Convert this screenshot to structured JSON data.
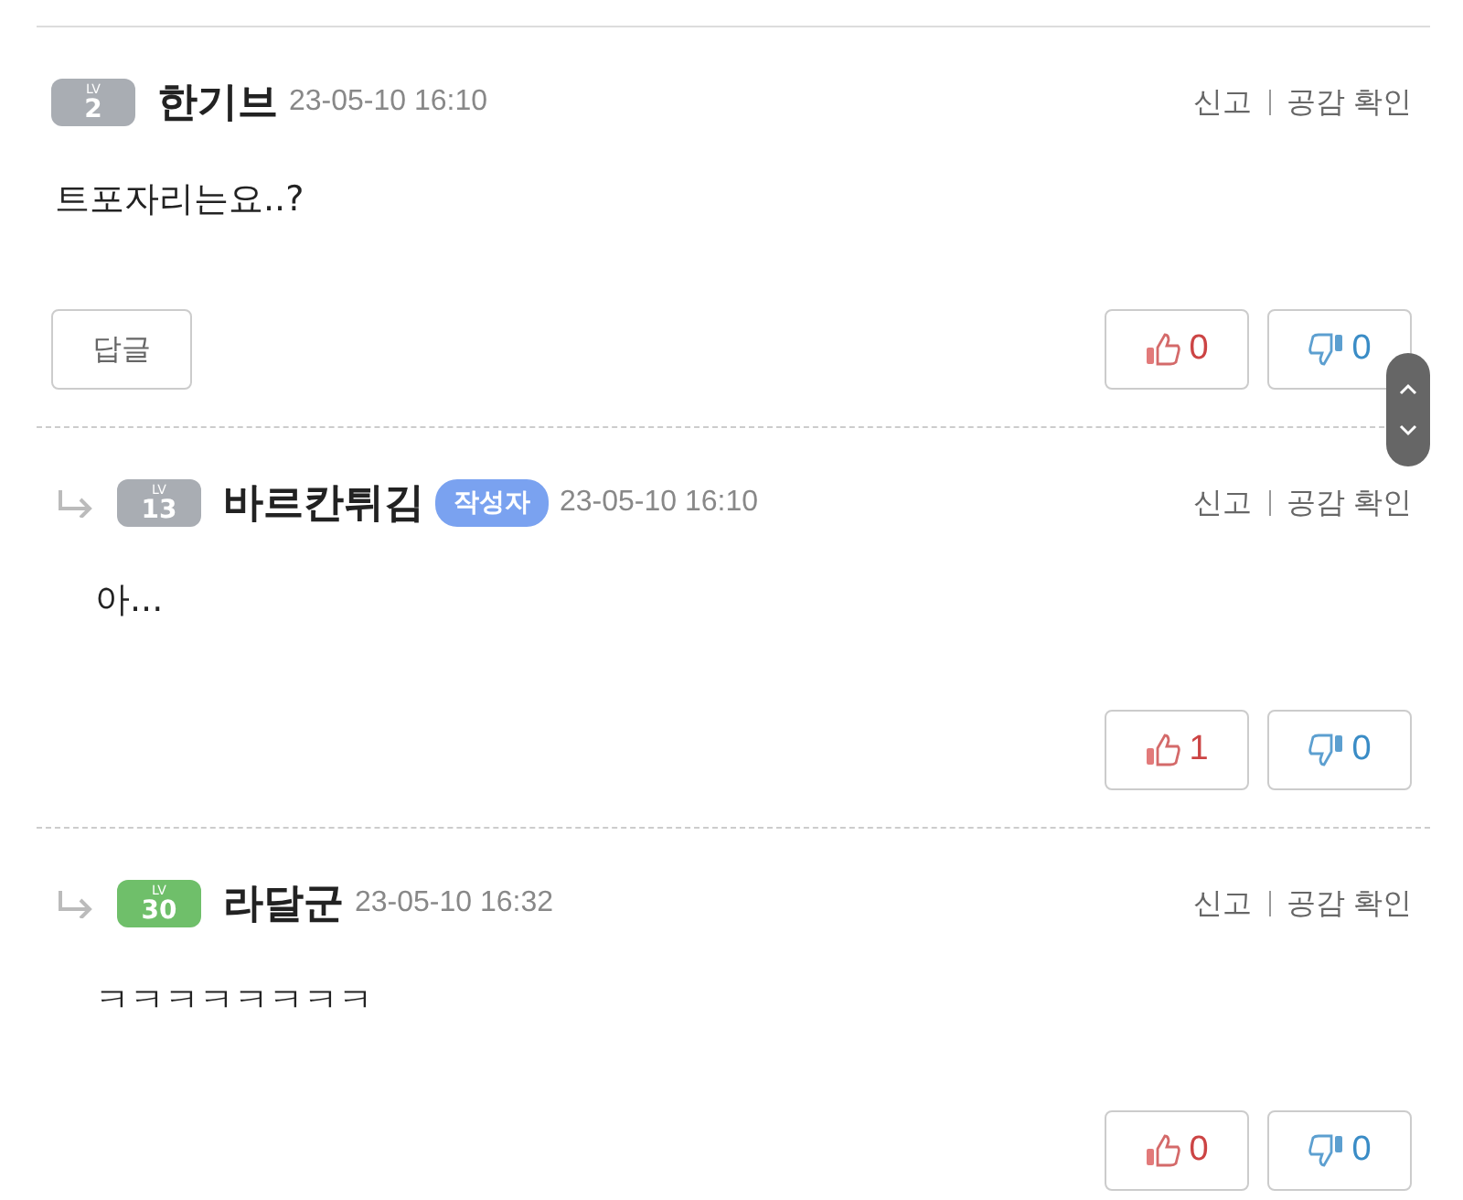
{
  "comments": [
    {
      "kind": "comment",
      "level": {
        "label": "LV",
        "number": "2",
        "color": "#a9adb3"
      },
      "author": "한기브",
      "time": "23-05-10 16:10",
      "report": "신고",
      "likes_check": "공감 확인",
      "body": "트포자리는요..?",
      "reply_button": "답글",
      "up": "0",
      "down": "0"
    },
    {
      "kind": "reply",
      "level": {
        "label": "LV",
        "number": "13",
        "color": "#a9adb3"
      },
      "author": "바르칸튀김",
      "author_badge": "작성자",
      "time": "23-05-10 16:10",
      "report": "신고",
      "likes_check": "공감 확인",
      "body": "아...",
      "up": "1",
      "down": "0"
    },
    {
      "kind": "reply",
      "level": {
        "label": "LV",
        "number": "30",
        "color": "#6fbf6a"
      },
      "author": "라달군",
      "time": "23-05-10 16:32",
      "report": "신고",
      "likes_check": "공감 확인",
      "body": "ㅋㅋㅋㅋㅋㅋㅋㅋ",
      "up": "0",
      "down": "0"
    }
  ]
}
